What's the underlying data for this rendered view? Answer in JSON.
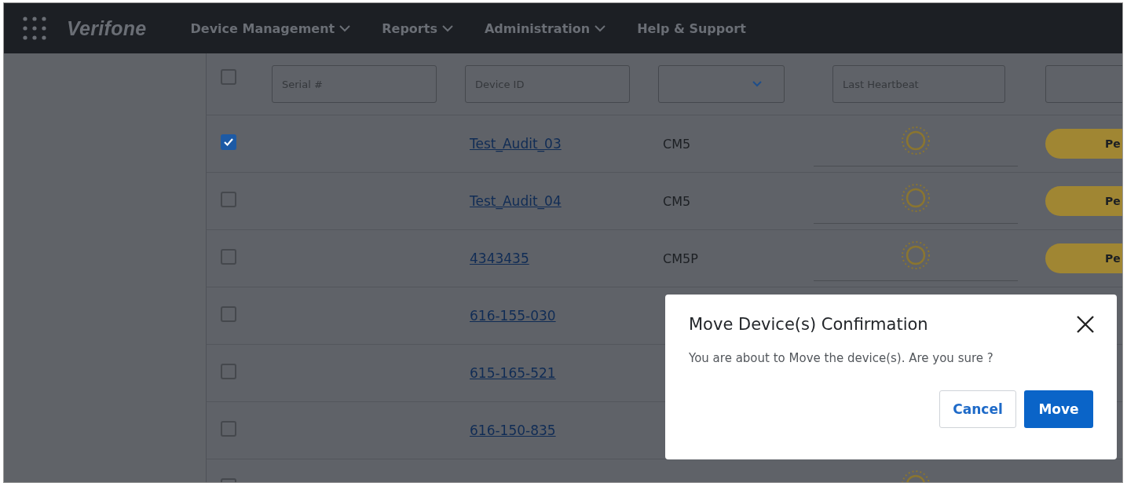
{
  "nav": {
    "logo": "Verifone",
    "menus": [
      {
        "label": "Device Management",
        "dropdown": true
      },
      {
        "label": "Reports",
        "dropdown": true
      },
      {
        "label": "Administration",
        "dropdown": true
      },
      {
        "label": "Help & Support",
        "dropdown": false
      }
    ]
  },
  "filters": {
    "select_all_checked": false,
    "serial_placeholder": "Serial #",
    "device_id_placeholder": "Device ID",
    "last_heartbeat_placeholder": "Last Heartbeat"
  },
  "rows": [
    {
      "checked": true,
      "device_id": "Test_Audit_03",
      "model": "CM5",
      "status": "Pe"
    },
    {
      "checked": false,
      "device_id": "Test_Audit_04",
      "model": "CM5",
      "status": "Pe"
    },
    {
      "checked": false,
      "device_id": "4343435",
      "model": "CM5P",
      "status": "Pe"
    },
    {
      "checked": false,
      "device_id": "616-155-030"
    },
    {
      "checked": false,
      "device_id": "615-165-521"
    },
    {
      "checked": false,
      "device_id": "616-150-835"
    },
    {
      "checked": false
    }
  ],
  "dialog": {
    "title": "Move Device(s) Confirmation",
    "message": "You are about to Move the device(s). Are you sure ?",
    "cancel": "Cancel",
    "confirm": "Move"
  }
}
